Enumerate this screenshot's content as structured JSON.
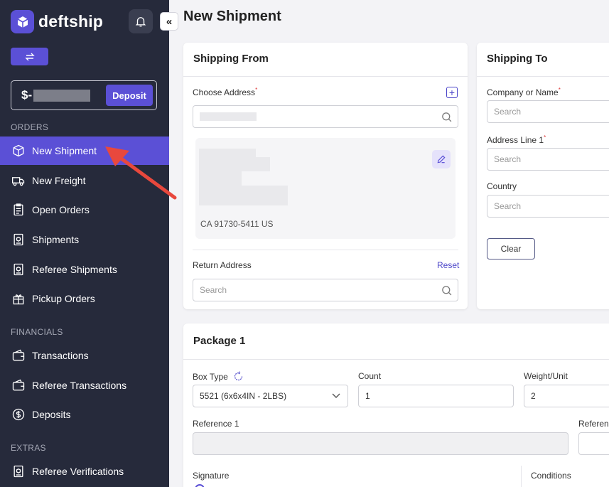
{
  "brand": {
    "name": "deftship"
  },
  "sidebar": {
    "balance_prefix": "$-",
    "deposit_label": "Deposit",
    "sections": {
      "orders": "ORDERS",
      "financials": "FINANCIALS",
      "extras": "EXTRAS"
    },
    "items": [
      {
        "label": "New Shipment",
        "icon": "box-icon",
        "active": true
      },
      {
        "label": "New Freight",
        "icon": "truck-icon"
      },
      {
        "label": "Open Orders",
        "icon": "clipboard-icon"
      },
      {
        "label": "Shipments",
        "icon": "package-list-icon"
      },
      {
        "label": "Referee Shipments",
        "icon": "package-list-icon"
      },
      {
        "label": "Pickup Orders",
        "icon": "pickup-icon"
      },
      {
        "label": "Transactions",
        "icon": "wallet-icon"
      },
      {
        "label": "Referee Transactions",
        "icon": "wallet-icon"
      },
      {
        "label": "Deposits",
        "icon": "dollar-icon"
      },
      {
        "label": "Referee Verifications",
        "icon": "verify-icon"
      }
    ]
  },
  "main": {
    "title": "New Shipment",
    "shipping_from": {
      "title": "Shipping From",
      "choose_address_label": "Choose Address",
      "required_mark": "*",
      "address_line": "CA 91730-5411 US",
      "return_address_label": "Return Address",
      "reset_label": "Reset",
      "return_placeholder": "Search"
    },
    "shipping_to": {
      "title": "Shipping To",
      "company_label": "Company or Name",
      "company_placeholder": "Search",
      "address_label": "Address Line 1",
      "address_placeholder": "Search",
      "country_label": "Country",
      "country_placeholder": "Search",
      "clear_label": "Clear",
      "required_mark": "*"
    },
    "package": {
      "title": "Package 1",
      "box_type_label": "Box Type",
      "box_type_value": "5521 (6x6x4IN - 2LBS)",
      "count_label": "Count",
      "count_value": "1",
      "weight_label": "Weight/Unit",
      "weight_value": "2",
      "reference1_label": "Reference 1",
      "reference2_label": "Referenc",
      "signature_label": "Signature",
      "conditions_label": "Conditions"
    }
  },
  "colors": {
    "accent": "#5b50d6",
    "sidebar_bg": "#262a3b",
    "pointer_arrow": "#e8483d"
  }
}
